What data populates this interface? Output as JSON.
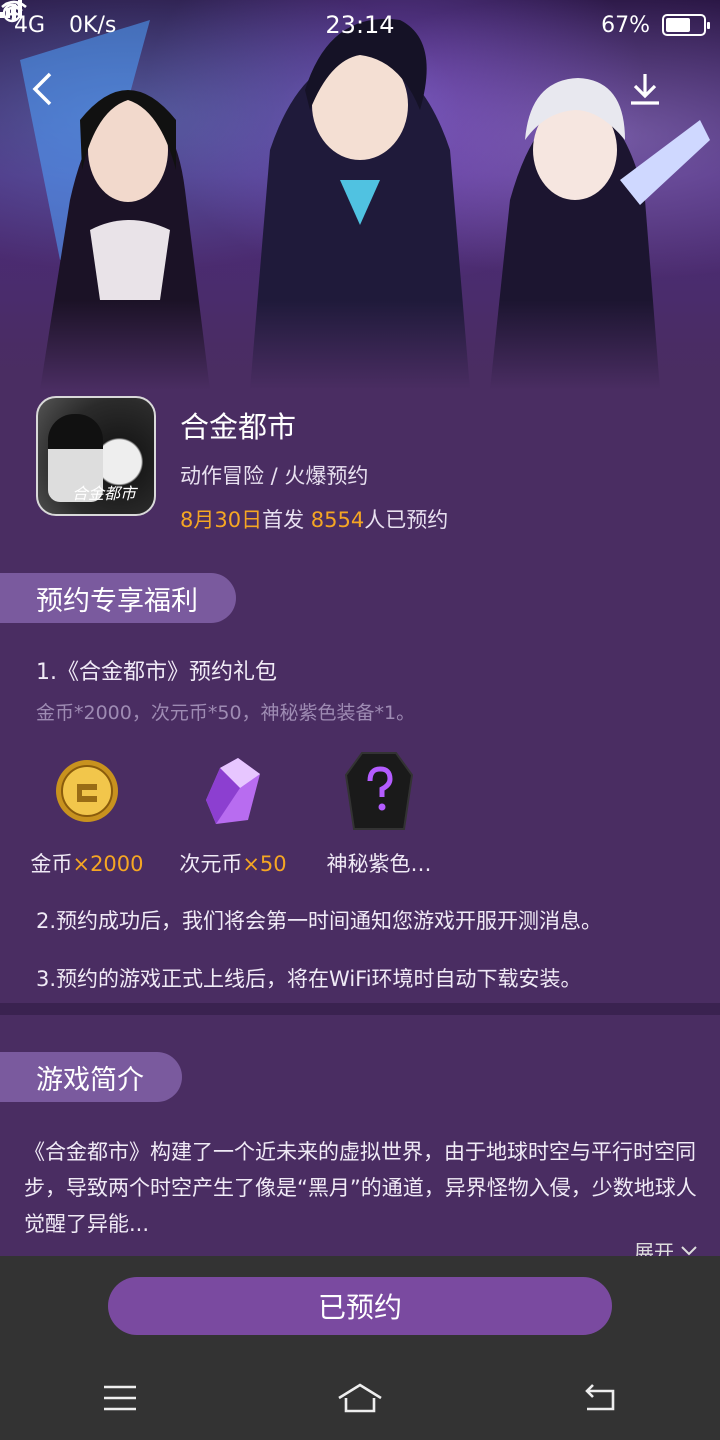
{
  "status_bar": {
    "network": "4G",
    "speed": "0K/s",
    "time": "23:14",
    "battery_text": "67%",
    "battery_level": 0.67
  },
  "app": {
    "name": "合金都市",
    "category": "动作冒险 / 火爆预约",
    "release_date": "8月30日",
    "release_suffix": "首发",
    "reservations_count": "8554",
    "reservations_suffix": "人已预约",
    "icon_logo_text": "合金都市"
  },
  "benefits": {
    "title": "预约专享福利",
    "gift_title": "1.《合金都市》预约礼包",
    "gift_desc": "金币*2000，次元币*50，神秘紫色装备*1。",
    "rewards": [
      {
        "icon": "gold-coin-icon",
        "name": "金币",
        "qty": "×2000"
      },
      {
        "icon": "purple-crystal-icon",
        "name": "次元币",
        "qty": "×50"
      },
      {
        "icon": "mystery-armor-icon",
        "name": "神秘紫色…",
        "qty": ""
      }
    ],
    "note2": "2.预约成功后，我们将会第一时间通知您游戏开服开测消息。",
    "note3": "3.预约的游戏正式上线后，将在WiFi环境时自动下载安装。"
  },
  "intro": {
    "title": "游戏简介",
    "text": "《合金都市》构建了一个近未来的虚拟世界，由于地球时空与平行时空同步，导致两个时空产生了像是“黑月”的通道，异界怪物入侵，少数地球人觉醒了异能...",
    "expand_label": "展开"
  },
  "action": {
    "reserve_label": "已预约"
  },
  "colors": {
    "accent": "#7a4aa0",
    "highlight": "#f5a623",
    "background": "#4a2d62"
  }
}
